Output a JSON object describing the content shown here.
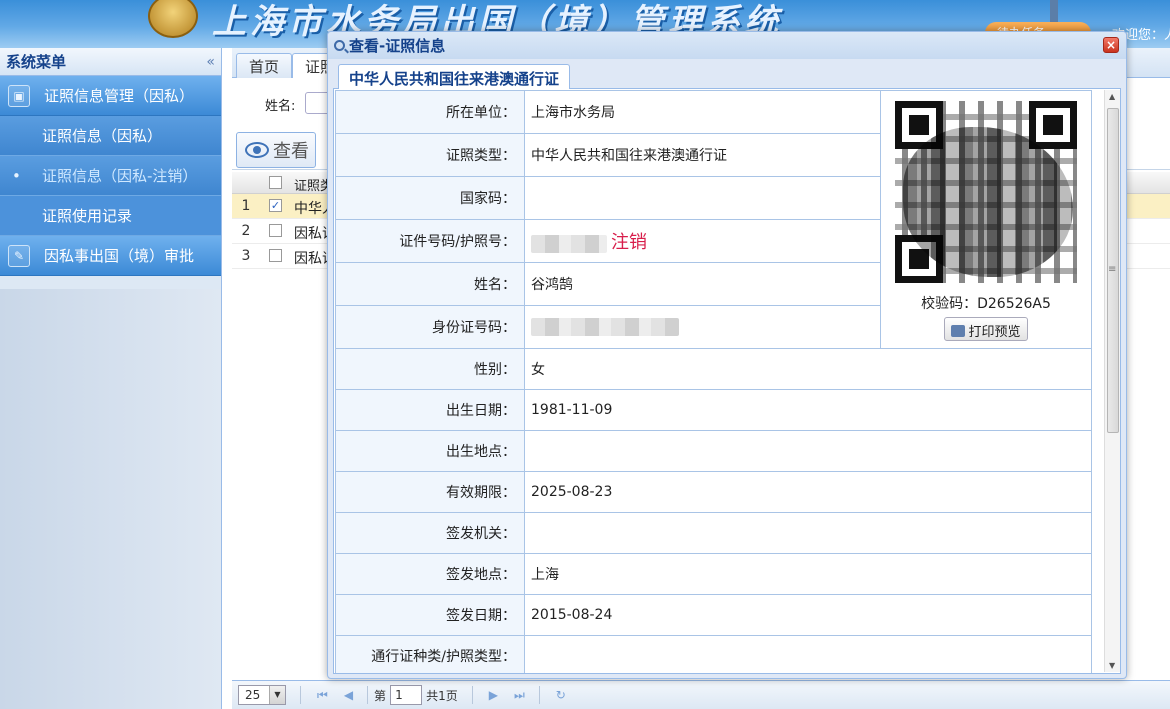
{
  "header": {
    "title": "上海市水务局出国（境）管理系统",
    "task_label": "待办任务",
    "welcome": "欢迎您：人事"
  },
  "sidebar": {
    "title": "系统菜单",
    "collapse_icon": "double-chevron-left-icon",
    "groups": [
      {
        "label": "证照信息管理（因私）",
        "icon": "image-icon",
        "items": [
          {
            "label": "证照信息（因私）"
          },
          {
            "label": "证照信息（因私-注销）",
            "active": true
          },
          {
            "label": "证照使用记录"
          }
        ]
      },
      {
        "label": "因私事出国（境）审批",
        "icon": "edit-icon",
        "items": []
      }
    ]
  },
  "main": {
    "tabs": [
      {
        "label": "首页"
      },
      {
        "label": "证照"
      }
    ],
    "search": {
      "name_label": "姓名:",
      "name_value": ""
    },
    "toolbar": {
      "view_label": "查看"
    },
    "grid": {
      "header": "证照类",
      "rows": [
        {
          "num": "1",
          "checked": true,
          "text": "中华人"
        },
        {
          "num": "2",
          "checked": false,
          "text": "因私证"
        },
        {
          "num": "3",
          "checked": false,
          "text": "因私证"
        }
      ]
    },
    "pager": {
      "page_size": "25",
      "page_prefix": "第",
      "page": "1",
      "page_total": "共1页"
    }
  },
  "dialog": {
    "title": "查看-证照信息",
    "tab": "中华人民共和国往来港澳通行证",
    "close_icon": "close-icon",
    "fields": [
      {
        "label": "所在单位：",
        "value": "上海市水务局"
      },
      {
        "label": "证照类型：",
        "value": "中华人民共和国往来港澳通行证"
      },
      {
        "label": "国家码：",
        "value": ""
      },
      {
        "label": "证件号码/护照号：",
        "value": "",
        "status": "注销"
      },
      {
        "label": "姓名：",
        "value": "谷鸿鹄"
      },
      {
        "label": "身份证号码：",
        "value": ""
      },
      {
        "label": "性别：",
        "value": "女"
      },
      {
        "label": "出生日期：",
        "value": "1981-11-09"
      },
      {
        "label": "出生地点：",
        "value": ""
      },
      {
        "label": "有效期限：",
        "value": "2025-08-23"
      },
      {
        "label": "签发机关：",
        "value": ""
      },
      {
        "label": "签发地点：",
        "value": "上海"
      },
      {
        "label": "签发日期：",
        "value": "2015-08-24"
      },
      {
        "label": "通行证种类/护照类型：",
        "value": ""
      }
    ],
    "qr": {
      "check_code": "校验码：D26526A5",
      "print_label": "打印预览"
    }
  }
}
